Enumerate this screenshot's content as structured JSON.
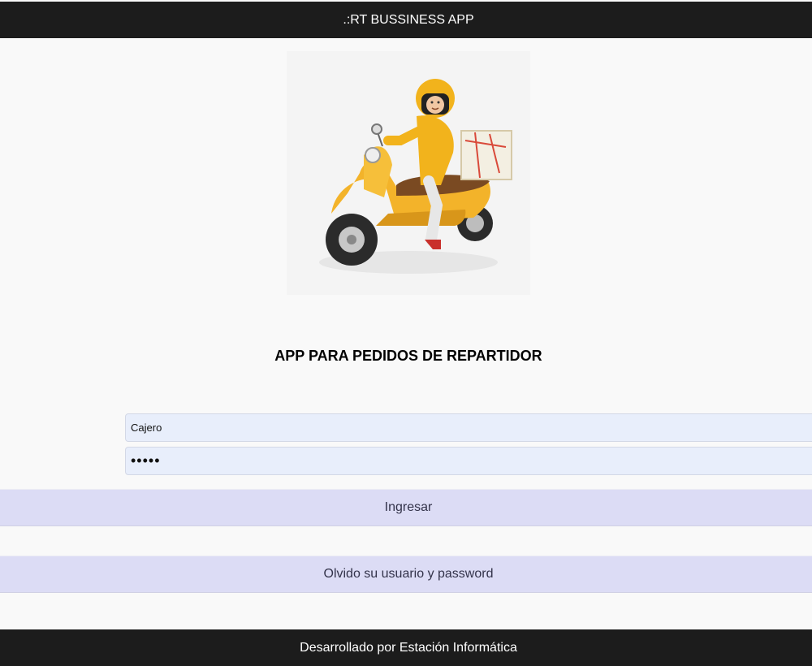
{
  "header": {
    "title": ".:RT BUSSINESS APP"
  },
  "hero": {
    "alt": "Repartidor en moto con paquete"
  },
  "main": {
    "heading": "APP PARA PEDIDOS DE REPARTIDOR"
  },
  "login": {
    "username_value": "Cajero",
    "password_value": "•••••",
    "submit_label": "Ingresar",
    "forgot_label": "Olvido su usuario y password"
  },
  "footer": {
    "text": "Desarrollado por Estación Informática"
  },
  "colors": {
    "bar_background": "#1c1c1c",
    "input_background": "#e8eefb",
    "button_background": "#dcdcf5",
    "helmet_yellow": "#f2b31c"
  }
}
